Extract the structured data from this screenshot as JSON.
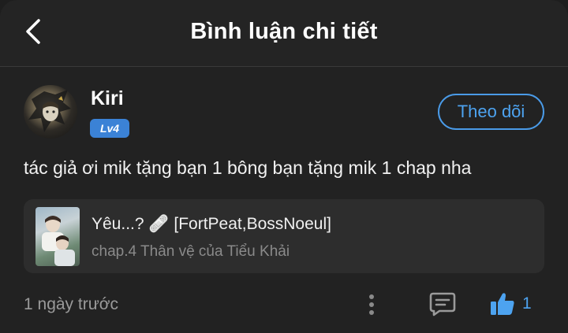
{
  "header": {
    "title": "Bình luận chi tiết",
    "back_icon": "chevron-left-icon"
  },
  "comment": {
    "username": "Kiri",
    "level": "Lv4",
    "follow_label": "Theo dõi",
    "text": "tác giả ơi mik tặng bạn 1 bông bạn tặng mik 1 chap nha",
    "timestamp": "1 ngày trước",
    "like_count": "1"
  },
  "story": {
    "title": "Yêu...? 🩹 [FortPeat,BossNoeul]",
    "chapter": "chap.4 Thân vệ của Tiểu Khải"
  },
  "colors": {
    "accent": "#4da3f0",
    "badge": "#3b82d6",
    "background": "#222222",
    "card": "#2d2d2d"
  }
}
